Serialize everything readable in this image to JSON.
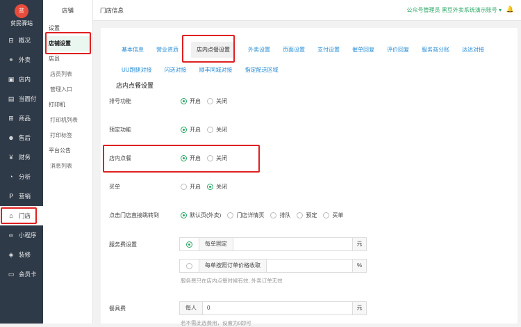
{
  "sidebar": {
    "brand_name": "贫民驿站",
    "logo_text": "贫",
    "items": [
      {
        "label": "概况",
        "icon": "overview-icon",
        "glyph": "⊟"
      },
      {
        "label": "外卖",
        "icon": "scooter-icon",
        "glyph": "⚭"
      },
      {
        "label": "店内",
        "icon": "shop-icon",
        "glyph": "▣"
      },
      {
        "label": "当面付",
        "icon": "pay-icon",
        "glyph": "▤"
      },
      {
        "label": "商品",
        "icon": "goods-icon",
        "glyph": "⊞"
      },
      {
        "label": "售后",
        "icon": "aftersale-icon",
        "glyph": "☻"
      },
      {
        "label": "财务",
        "icon": "finance-icon",
        "glyph": "¥"
      },
      {
        "label": "分析",
        "icon": "analysis-icon",
        "glyph": "◔"
      },
      {
        "label": "营销",
        "icon": "marketing-icon",
        "glyph": "ℙ"
      },
      {
        "label": "门店",
        "icon": "store-icon",
        "glyph": "⌂"
      },
      {
        "label": "小程序",
        "icon": "miniprogram-icon",
        "glyph": "∞"
      },
      {
        "label": "装修",
        "icon": "decorate-icon",
        "glyph": "◈"
      },
      {
        "label": "会员卡",
        "icon": "member-card-icon",
        "glyph": "▭"
      }
    ]
  },
  "subnav": {
    "title": "店铺",
    "items": [
      {
        "label": "设置",
        "child": false
      },
      {
        "label": "店铺设置",
        "child": false
      },
      {
        "label": "店员",
        "child": false
      },
      {
        "label": "店员列表",
        "child": true
      },
      {
        "label": "管理入口",
        "child": true
      },
      {
        "label": "打印机",
        "child": false
      },
      {
        "label": "打印机列表",
        "child": true
      },
      {
        "label": "打印标签",
        "child": true
      },
      {
        "label": "平台公告",
        "child": false
      },
      {
        "label": "消息列表",
        "child": true
      }
    ]
  },
  "header": {
    "title": "门店信息",
    "account": "公众号管理员 黑豆外卖系统演示账号",
    "chevron": "▾",
    "bell": "🔔"
  },
  "tabs": [
    "基本信息",
    "营业资质",
    "店内点餐设置",
    "外卖设置",
    "页面设置",
    "支付设置",
    "催单回复",
    "评价回复",
    "服务商分账",
    "达达对接",
    "UU跑腿对接",
    "闪送对接",
    "顺丰同城对接",
    "指定配送区域"
  ],
  "section_title": "店内点餐设置",
  "settings": {
    "queue": {
      "label": "排号功能",
      "opts": [
        "开启",
        "关闭"
      ]
    },
    "reserve": {
      "label": "预定功能",
      "opts": [
        "开启",
        "关闭"
      ]
    },
    "dinein": {
      "label": "店内点餐",
      "opts": [
        "开启",
        "关闭"
      ]
    },
    "bill": {
      "label": "买单",
      "opts": [
        "开启",
        "关闭"
      ]
    },
    "jump": {
      "label": "点击门店直接跳转到",
      "opts": [
        "默认页(外卖)",
        "门店详情页",
        "排队",
        "预定",
        "买单"
      ]
    },
    "service": {
      "label": "服务费设置",
      "fixed_label": "每单固定",
      "fixed_unit": "元",
      "pct_label": "每单按照订单价格收取",
      "pct_unit": "%",
      "hint": "服务费只在店内点餐时候有效, 外卖订单无效"
    },
    "tableware": {
      "label": "餐具费",
      "prefix": "每人",
      "value": "0",
      "unit": "元",
      "hint": "若不需此选费用，设置为0即可"
    }
  },
  "colors": {
    "accent": "#2aa766",
    "nav_bg": "#2f3a48",
    "highlight": "#e02020",
    "link": "#2a8fd6"
  }
}
